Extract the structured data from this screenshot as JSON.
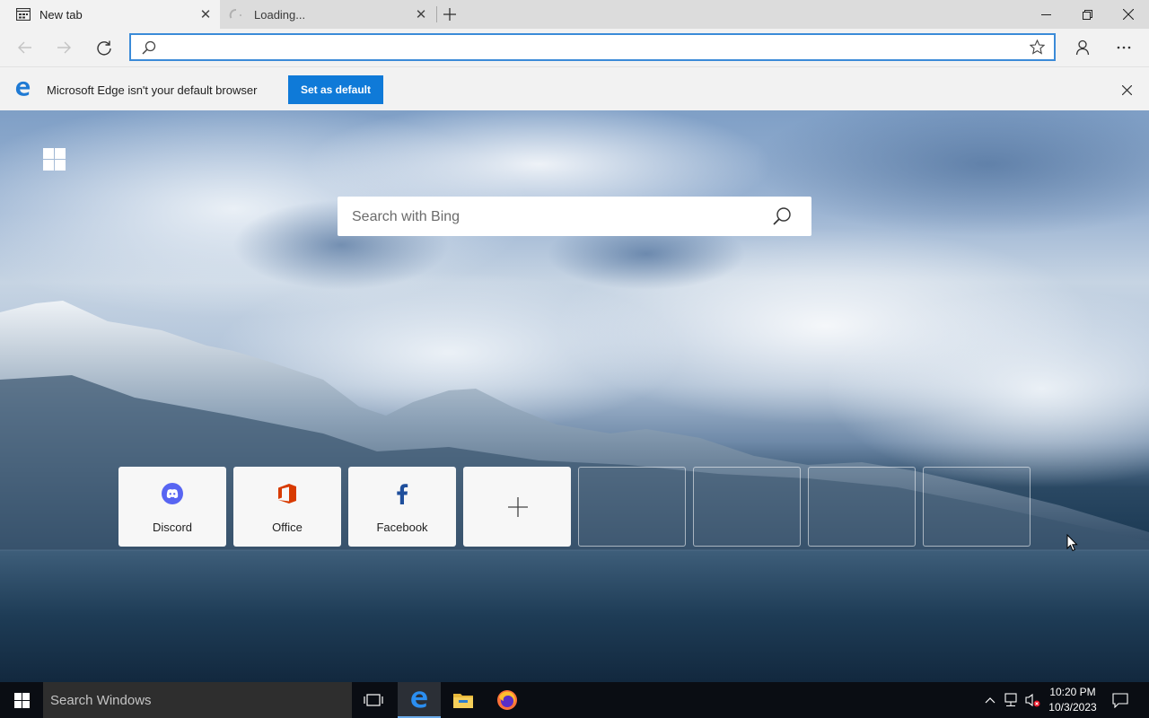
{
  "browser": {
    "tabs": [
      {
        "label": "New tab",
        "icon": "new-tab-page-icon",
        "active": true
      },
      {
        "label": "Loading...",
        "icon": "loading-spinner-icon",
        "active": false
      }
    ],
    "address_value": "",
    "address_placeholder": ""
  },
  "infobar": {
    "message": "Microsoft Edge isn't your default browser",
    "button_label": "Set as default"
  },
  "ntp": {
    "search_placeholder": "Search with Bing",
    "tiles": [
      {
        "label": "Discord",
        "icon": "discord-icon",
        "color": "#5865f2"
      },
      {
        "label": "Office",
        "icon": "office-icon",
        "color": "#d83b01"
      },
      {
        "label": "Facebook",
        "icon": "facebook-icon",
        "color": "#1877f2"
      }
    ],
    "add_tile_icon": "plus-icon",
    "empty_tiles": 4
  },
  "taskbar": {
    "search_placeholder": "Search Windows",
    "apps": [
      "task-view-icon",
      "edge-icon",
      "file-explorer-icon",
      "firefox-icon"
    ],
    "time": "10:20 PM",
    "date": "10/3/2023"
  },
  "colors": {
    "accent": "#0f7ad8",
    "address_focus": "#3b8bd8",
    "taskbar": "#0a0d13"
  }
}
